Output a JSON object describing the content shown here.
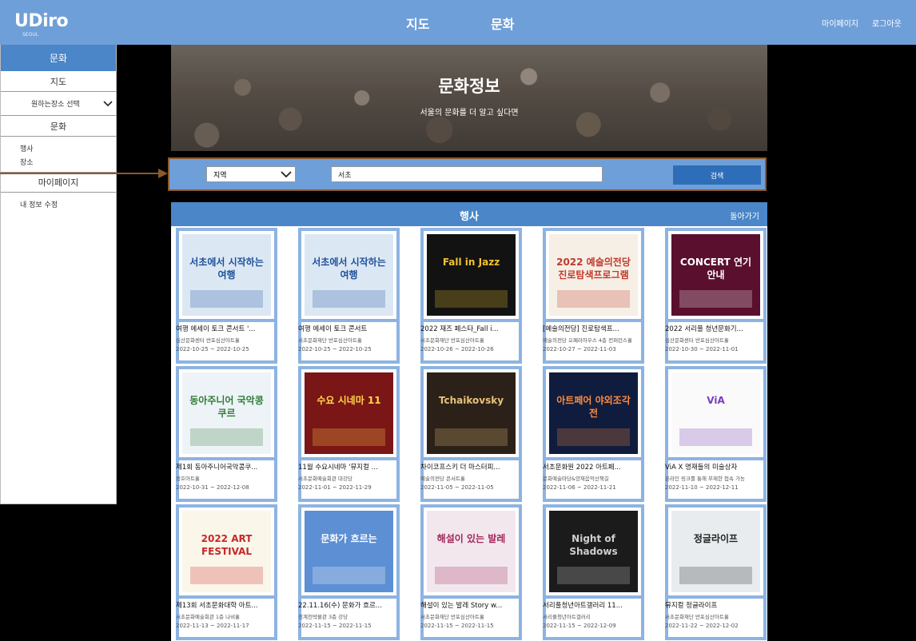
{
  "app": {
    "logo": "UDiro",
    "logo_sub": "SEOUL"
  },
  "nav": {
    "map": "지도",
    "culture": "문화"
  },
  "top_links": {
    "mypage": "마이페이지",
    "logout": "로그아웃"
  },
  "sidebar": {
    "active": "문화",
    "map_heading": "지도",
    "place_select": "원하는장소 선택",
    "culture_heading": "문화",
    "sub_items": [
      "행사",
      "장소"
    ],
    "mypage_heading": "마이페이지",
    "edit_info": "내 정보 수정"
  },
  "hero": {
    "title": "문화정보",
    "subtitle": "서울의 문화를 더 알고 싶다면"
  },
  "search": {
    "region": "지역",
    "query": "서초",
    "button": "검색"
  },
  "events": {
    "title": "행사",
    "back": "돌아가기",
    "items": [
      {
        "title": "여행 에세이 토크 콘서트 '...",
        "place": "심산문화센터 반포심산아트홀",
        "date": "2022-10-25 ~ 2022-10-25",
        "poster_text": "서초에서 시작하는 여행",
        "poster_bg": "#dbe8f4",
        "poster_fg": "#1f4f9a"
      },
      {
        "title": "여행 에세이 토크 콘서트",
        "place": "서초문화재단 반포심산아트홀",
        "date": "2022-10-25 ~ 2022-10-25",
        "poster_text": "서초에서 시작하는 여행",
        "poster_bg": "#dbe8f4",
        "poster_fg": "#1f4f9a"
      },
      {
        "title": "2022 재즈 페스타_Fall i...",
        "place": "서초문화재단 반포심산아트홀",
        "date": "2022-10-26 ~ 2022-10-26",
        "poster_text": "Fall in Jazz",
        "poster_bg": "#121212",
        "poster_fg": "#f1c232"
      },
      {
        "title": "[예술의전당] 진로탐색프...",
        "place": "예술의전당 오페라하우스 4층 컨퍼런스홀",
        "date": "2022-10-27 ~ 2022-11-03",
        "poster_text": "2022 예술의전당 진로탐색프로그램",
        "poster_bg": "#f6efe6",
        "poster_fg": "#c0392b"
      },
      {
        "title": "2022 서리풀 청년문화기...",
        "place": "심산문화센터 반포심산아트홀",
        "date": "2022-10-30 ~ 2022-11-01",
        "poster_text": "CONCERT 연기 안내",
        "poster_bg": "#5a0f2e",
        "poster_fg": "#ffffff"
      },
      {
        "title": "제1회 동아주니어국악콩쿠...",
        "place": "정호아트홀",
        "date": "2022-10-31 ~ 2022-12-08",
        "poster_text": "동아주니어 국악콩쿠르",
        "poster_bg": "#eef3f8",
        "poster_fg": "#2e7d32"
      },
      {
        "title": "11월 수요시네마 '뮤지컬 ...",
        "place": "서초문화예술회관 대강당",
        "date": "2022-11-01 ~ 2022-11-29",
        "poster_text": "수요 시네마 11",
        "poster_bg": "#7b1616",
        "poster_fg": "#ffd84d"
      },
      {
        "title": "차이코프스키 더 마스터피...",
        "place": "예술의전당 콘서트홀",
        "date": "2022-11-05 ~ 2022-11-05",
        "poster_text": "Tchaikovsky",
        "poster_bg": "#2b2118",
        "poster_fg": "#e8c27a"
      },
      {
        "title": "서초문화원 2022 아트페...",
        "place": "문화예술마당&양재음악산책길",
        "date": "2022-11-06 ~ 2022-11-21",
        "poster_text": "아트페어 야외조각전",
        "poster_bg": "#0f1c3d",
        "poster_fg": "#ff8a3d"
      },
      {
        "title": "ViA X 명재들의 미술상자",
        "place": "온라인 링크를 통해 무제한 접속 가능",
        "date": "2022-11-10 ~ 2022-12-11",
        "poster_text": "ViA",
        "poster_bg": "#fafafa",
        "poster_fg": "#7a3db8"
      },
      {
        "title": "제13회 서초문화대학 아트...",
        "place": "서초문화예술회관 1층 나비홀",
        "date": "2022-11-13 ~ 2022-11-17",
        "poster_text": "2022 ART FESTIVAL",
        "poster_bg": "#fbf6ea",
        "poster_fg": "#c62828"
      },
      {
        "title": "22.11.16(수) 문화가 흐르...",
        "place": "정계천박물관 3층 강당",
        "date": "2022-11-15 ~ 2022-11-15",
        "poster_text": "문화가 흐르는",
        "poster_bg": "#5d8fd4",
        "poster_fg": "#ffffff"
      },
      {
        "title": "해설이 있는 발레 Story w...",
        "place": "서초문화재단 반포심산아트홀",
        "date": "2022-11-15 ~ 2022-11-15",
        "poster_text": "해설이 있는 발레",
        "poster_bg": "#f3e7ee",
        "poster_fg": "#a0275a"
      },
      {
        "title": "서리풀청년아트갤러리 11...",
        "place": "서리풀청년아트갤러리",
        "date": "2022-11-15 ~ 2022-12-09",
        "poster_text": "Night of Shadows",
        "poster_bg": "#1b1b1b",
        "poster_fg": "#cfcfcf"
      },
      {
        "title": "뮤지컬 정글라이프",
        "place": "서초문화재단 반포심산아트홀",
        "date": "2022-11-22 ~ 2022-12-02",
        "poster_text": "정글라이프",
        "poster_bg": "#e9ecef",
        "poster_fg": "#222222"
      }
    ]
  }
}
